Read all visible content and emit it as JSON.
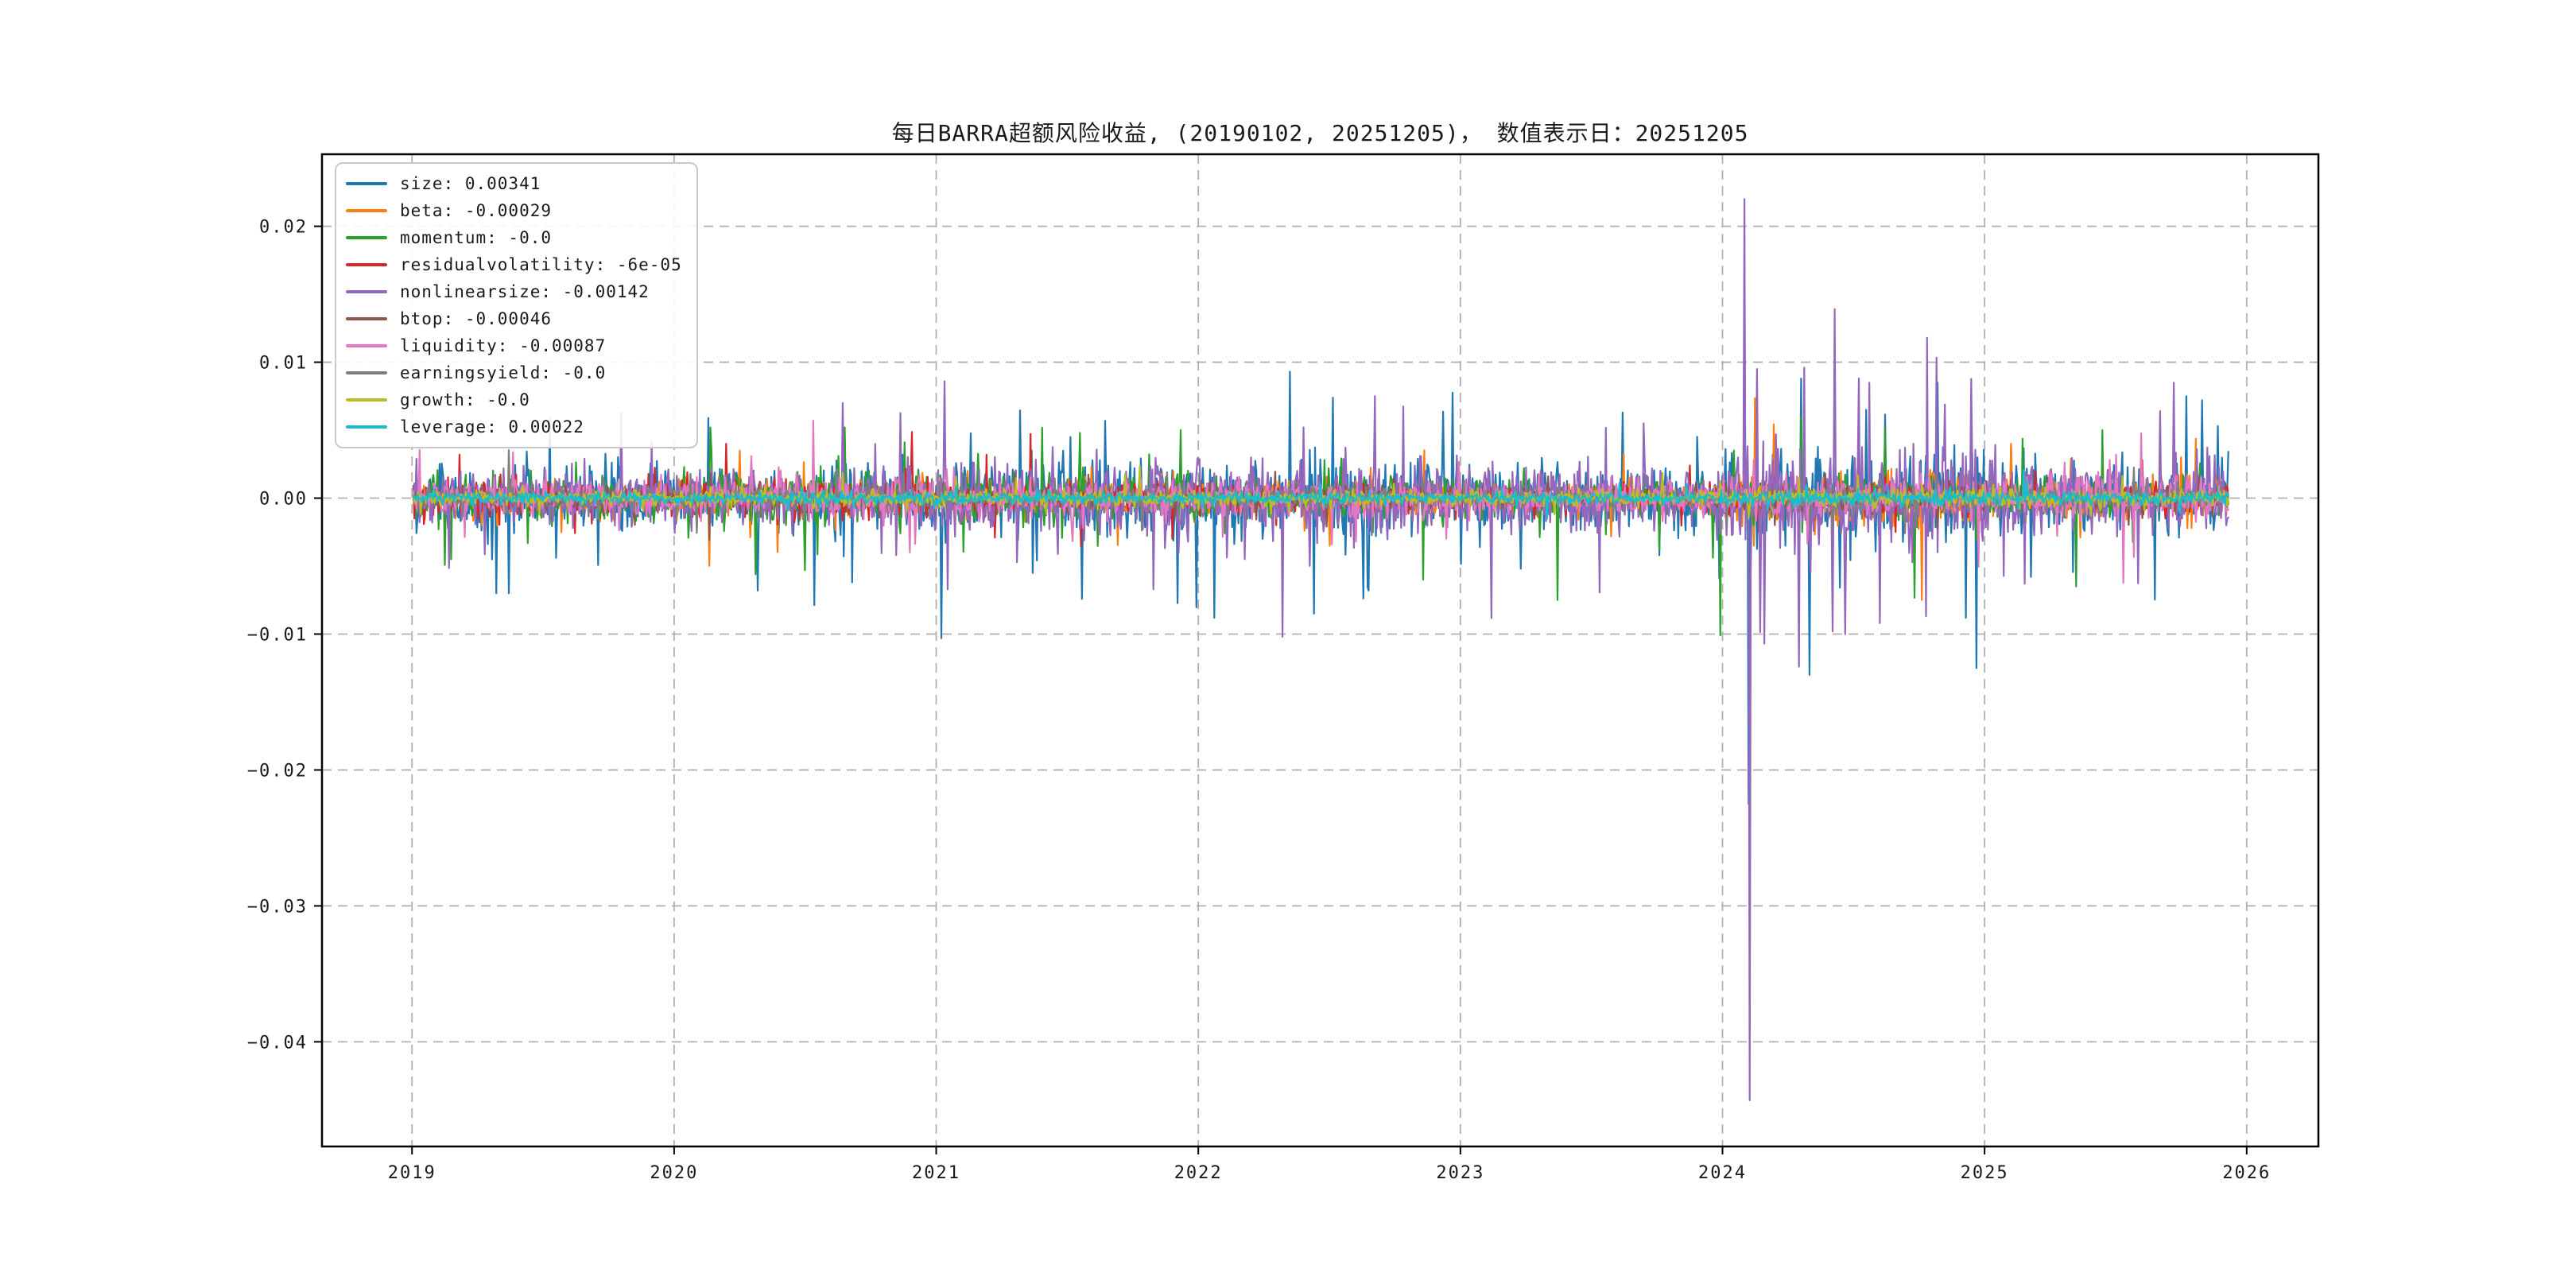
{
  "chart_data": {
    "type": "line",
    "title": "每日BARRA超额风险收益, (20190102, 20251205)，  数值表示日：20251205",
    "xlim": [
      2018.6565,
      2026.2736
    ],
    "ylim": [
      -0.0477,
      0.0253
    ],
    "x_ticks": [
      {
        "value": 2019,
        "label": "2019"
      },
      {
        "value": 2020,
        "label": "2020"
      },
      {
        "value": 2021,
        "label": "2021"
      },
      {
        "value": 2022,
        "label": "2022"
      },
      {
        "value": 2023,
        "label": "2023"
      },
      {
        "value": 2024,
        "label": "2024"
      },
      {
        "value": 2025,
        "label": "2025"
      },
      {
        "value": 2026,
        "label": "2026"
      }
    ],
    "y_ticks": [
      {
        "value": 0.02,
        "label": "0.02"
      },
      {
        "value": 0.01,
        "label": "0.01"
      },
      {
        "value": 0.0,
        "label": "0.00"
      },
      {
        "value": -0.01,
        "label": "−0.01"
      },
      {
        "value": -0.02,
        "label": "−0.02"
      },
      {
        "value": -0.03,
        "label": "−0.03"
      },
      {
        "value": -0.04,
        "label": "−0.04"
      }
    ],
    "grid": {
      "on": true,
      "color": "#b0b0b0",
      "dash": [
        12,
        8
      ]
    },
    "legend_position": "upper-left",
    "t_start": 2019.005,
    "t_end": 2025.93,
    "n_points": 1730,
    "series": [
      {
        "name": "size",
        "legend_label": "size: 0.00341",
        "color": "#1f77b4",
        "seed": 101,
        "final_value": 0.00341,
        "amp_by_year": [
          1.7,
          1.8,
          2.1,
          2.1,
          1.7,
          2.4,
          1.8
        ],
        "events": [
          [
            2019.32,
            -0.007
          ],
          [
            2019.55,
            -0.0044
          ],
          [
            2020.13,
            0.0059
          ],
          [
            2020.32,
            -0.0068
          ],
          [
            2020.68,
            -0.0062
          ],
          [
            2021.02,
            -0.0103
          ],
          [
            2021.37,
            -0.0055
          ],
          [
            2022.06,
            -0.0088
          ],
          [
            2022.35,
            0.0093
          ],
          [
            2022.44,
            -0.0085
          ],
          [
            2022.65,
            -0.0068
          ],
          [
            2023.23,
            -0.0052
          ],
          [
            2023.62,
            0.0063
          ],
          [
            2024.085,
            0.0165
          ],
          [
            2024.1,
            -0.0225
          ],
          [
            2024.3,
            0.0088
          ],
          [
            2024.33,
            -0.013
          ],
          [
            2024.55,
            0.0065
          ],
          [
            2024.82,
            0.0085
          ],
          [
            2024.93,
            -0.0088
          ],
          [
            2024.97,
            -0.0125
          ],
          [
            2025.77,
            0.0075
          ],
          [
            2025.83,
            0.0072
          ],
          [
            2025.89,
            0.0053
          ]
        ]
      },
      {
        "name": "beta",
        "legend_label": "beta: -0.00029",
        "color": "#ff7f0e",
        "seed": 102,
        "final_value": -0.00029,
        "amp_by_year": [
          0.7,
          1.0,
          1.1,
          0.9,
          0.8,
          1.5,
          1.1
        ],
        "events": [
          [
            2020.25,
            0.0035
          ],
          [
            2022.5,
            -0.0035
          ],
          [
            2024.12,
            -0.0035
          ],
          [
            2024.76,
            -0.0075
          ],
          [
            2025.1,
            0.004
          ],
          [
            2025.75,
            0.003
          ]
        ]
      },
      {
        "name": "momentum",
        "legend_label": "momentum: -0.0",
        "color": "#2ca02c",
        "seed": 103,
        "final_value": -4e-05,
        "amp_by_year": [
          1.2,
          1.6,
          1.4,
          1.2,
          1.1,
          1.4,
          1.0
        ],
        "events": [
          [
            2019.15,
            -0.0045
          ],
          [
            2020.14,
            0.0052
          ],
          [
            2020.31,
            -0.0056
          ],
          [
            2020.5,
            -0.0053
          ],
          [
            2020.65,
            0.0052
          ],
          [
            2021.55,
            0.0048
          ],
          [
            2022.86,
            -0.006
          ],
          [
            2023.37,
            -0.0075
          ],
          [
            2023.99,
            -0.0101
          ],
          [
            2024.3,
            0.006
          ],
          [
            2024.62,
            0.0052
          ],
          [
            2025.35,
            -0.0065
          ],
          [
            2025.45,
            0.005
          ]
        ]
      },
      {
        "name": "residualvolatility",
        "legend_label": "residualvolatility: -6e-05",
        "color": "#d62728",
        "seed": 104,
        "final_value": -6e-05,
        "amp_by_year": [
          0.9,
          1.1,
          0.9,
          0.8,
          0.7,
          1.0,
          0.8
        ],
        "events": [
          [
            2019.18,
            0.0032
          ],
          [
            2020.2,
            0.004
          ],
          [
            2021.9,
            -0.003
          ],
          [
            2024.13,
            0.0042
          ],
          [
            2025.6,
            0.0028
          ]
        ]
      },
      {
        "name": "nonlinearsize",
        "legend_label": "nonlinearsize: -0.00142",
        "color": "#9467bd",
        "seed": 105,
        "final_value": -0.00142,
        "amp_by_year": [
          1.5,
          1.7,
          2.1,
          2.1,
          1.8,
          3.0,
          2.1
        ],
        "events": [
          [
            2019.8,
            0.0063
          ],
          [
            2020.53,
            0.004
          ],
          [
            2020.645,
            0.007
          ],
          [
            2021.03,
            0.0086
          ],
          [
            2021.045,
            -0.0067
          ],
          [
            2021.83,
            -0.0067
          ],
          [
            2022.32,
            -0.0102
          ],
          [
            2022.4,
            0.0052
          ],
          [
            2023.7,
            0.0055
          ],
          [
            2024.085,
            0.022
          ],
          [
            2024.105,
            -0.0443
          ],
          [
            2024.13,
            0.0095
          ],
          [
            2024.16,
            -0.0107
          ],
          [
            2024.29,
            -0.0124
          ],
          [
            2024.31,
            0.0096
          ],
          [
            2024.42,
            -0.0098
          ],
          [
            2024.43,
            0.0139
          ],
          [
            2024.47,
            -0.01
          ],
          [
            2024.52,
            0.0088
          ],
          [
            2024.56,
            0.0085
          ],
          [
            2024.6,
            -0.0092
          ],
          [
            2024.78,
            0.0118
          ],
          [
            2025.67,
            0.0064
          ]
        ]
      },
      {
        "name": "btop",
        "legend_label": "btop: -0.00046",
        "color": "#8c564b",
        "seed": 106,
        "final_value": -0.00046,
        "amp_by_year": [
          0.5,
          0.55,
          0.5,
          0.5,
          0.45,
          0.6,
          0.5
        ],
        "events": [
          [
            2021.3,
            0.0018
          ],
          [
            2024.2,
            -0.002
          ]
        ]
      },
      {
        "name": "liquidity",
        "legend_label": "liquidity: -0.00087",
        "color": "#e377c2",
        "seed": 107,
        "final_value": -0.00087,
        "amp_by_year": [
          0.9,
          1.1,
          1.0,
          0.9,
          0.85,
          1.1,
          1.2
        ],
        "events": [
          [
            2020.53,
            0.0057
          ],
          [
            2020.9,
            -0.004
          ],
          [
            2022.6,
            -0.0032
          ],
          [
            2024.12,
            0.0028
          ],
          [
            2025.5,
            0.0032
          ]
        ]
      },
      {
        "name": "earningsyield",
        "legend_label": "earningsyield: -0.0",
        "color": "#7f7f7f",
        "seed": 108,
        "final_value": -3e-05,
        "amp_by_year": [
          0.5,
          0.55,
          0.5,
          0.5,
          0.45,
          0.65,
          0.55
        ],
        "events": [
          [
            2024.11,
            -0.0018
          ]
        ]
      },
      {
        "name": "growth",
        "legend_label": "growth: -0.0",
        "color": "#bcbd22",
        "seed": 109,
        "final_value": -2e-05,
        "amp_by_year": [
          0.4,
          0.45,
          0.45,
          0.4,
          0.4,
          0.5,
          0.45
        ],
        "events": [
          [
            2024.1,
            -0.0015
          ]
        ]
      },
      {
        "name": "leverage",
        "legend_label": "leverage: 0.00022",
        "color": "#17becf",
        "seed": 110,
        "final_value": 0.00022,
        "amp_by_year": [
          0.3,
          0.32,
          0.32,
          0.3,
          0.3,
          0.38,
          0.35
        ],
        "events": []
      }
    ]
  }
}
